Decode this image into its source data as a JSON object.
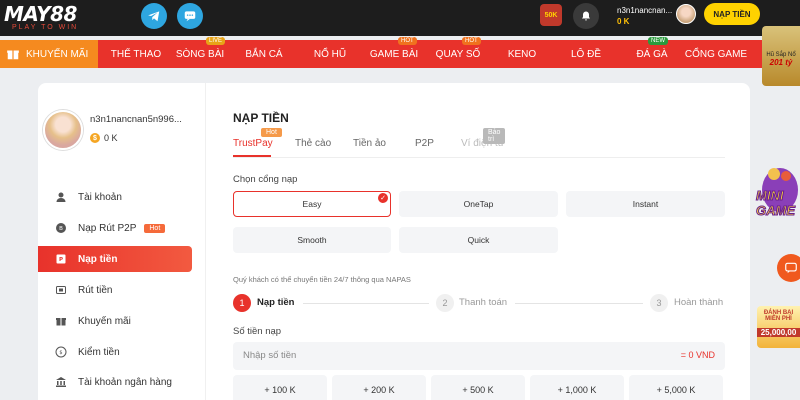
{
  "brand": {
    "name": "MAY88",
    "tagline": "PLAY TO WIN"
  },
  "header": {
    "gift_label": "50K",
    "username": "n3n1nancnan...",
    "balance": "0 K",
    "deposit_button": "NẠP TIỀN"
  },
  "nav": {
    "promo_label": "KHUYẾN MÃI",
    "items": [
      {
        "label": "THỂ THAO",
        "badge": ""
      },
      {
        "label": "SÒNG BÀI",
        "badge": "LIVE"
      },
      {
        "label": "BẮN CÁ",
        "badge": ""
      },
      {
        "label": "NỔ HŨ",
        "badge": ""
      },
      {
        "label": "GAME BÀI",
        "badge": "HOT"
      },
      {
        "label": "QUAY SỐ",
        "badge": "HOT"
      },
      {
        "label": "KENO",
        "badge": ""
      },
      {
        "label": "LÔ ĐỀ",
        "badge": ""
      },
      {
        "label": "ĐÁ GÀ",
        "badge": "NEW"
      },
      {
        "label": "CỔNG GAME",
        "badge": ""
      }
    ]
  },
  "side_promos": {
    "jackpot_top": "Hũ Sắp Nổ",
    "jackpot_value": "201 tỷ",
    "mini_game": "MINI GAME",
    "free_line1": "ĐÁNH BẠI",
    "free_line2": "MIỄN PHÍ",
    "free_amount": "25,000,00"
  },
  "sidebar": {
    "username": "n3n1nancnan5n996...",
    "balance": "0 K",
    "items": [
      {
        "label": "Tài khoản",
        "icon": "user-icon",
        "tag": ""
      },
      {
        "label": "Nạp Rút P2P",
        "icon": "bitcoin-icon",
        "tag": "Hot"
      },
      {
        "label": "Nạp tiền",
        "icon": "deposit-icon",
        "tag": ""
      },
      {
        "label": "Rút tiền",
        "icon": "withdraw-icon",
        "tag": ""
      },
      {
        "label": "Khuyến mãi",
        "icon": "gift-icon",
        "tag": ""
      },
      {
        "label": "Kiểm tiền",
        "icon": "coin-icon",
        "tag": ""
      },
      {
        "label": "Tài khoản ngân hàng",
        "icon": "bank-icon",
        "tag": ""
      }
    ]
  },
  "content": {
    "title": "NẠP TIỀN",
    "tabs": [
      {
        "label": "TrustPay",
        "badge": "Hot"
      },
      {
        "label": "Thẻ cào",
        "badge": ""
      },
      {
        "label": "Tiền ảo",
        "badge": ""
      },
      {
        "label": "P2P",
        "badge": ""
      },
      {
        "label": "Ví điện tử",
        "badge": "Bảo trì"
      }
    ],
    "gateway_label": "Chọn cổng nạp",
    "methods": [
      "Easy",
      "OneTap",
      "Instant",
      "Smooth",
      "Quick"
    ],
    "note": "Quý khách có thể chuyển tiền 24/7 thông qua NAPAS",
    "steps": [
      {
        "num": "1",
        "label": "Nạp tiền"
      },
      {
        "num": "2",
        "label": "Thanh toán"
      },
      {
        "num": "3",
        "label": "Hoàn thành"
      }
    ],
    "amount_label": "Số tiền nạp",
    "amount_placeholder": "Nhập số tiền",
    "amount_equiv": "= 0 VND",
    "quick_amounts": [
      "+ 100 K",
      "+ 200 K",
      "+ 500 K",
      "+ 1,000 K",
      "+ 5,000 K"
    ]
  }
}
